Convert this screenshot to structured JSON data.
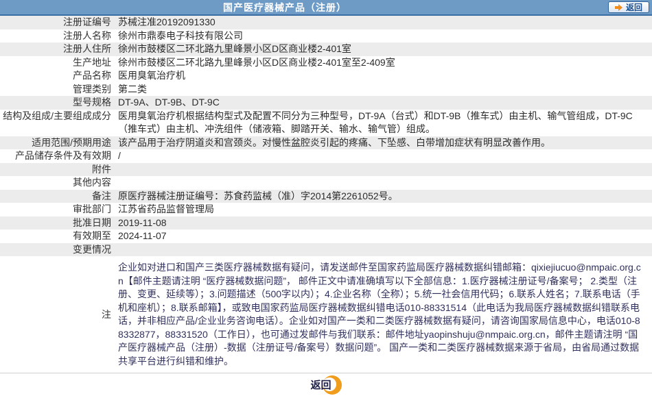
{
  "header": {
    "title": "国产医疗器械产品（注册）",
    "back_label": "返回"
  },
  "table": {
    "rows": [
      {
        "label": "注册证编号",
        "value": "苏械注准20192091330",
        "shaded": true
      },
      {
        "label": "注册人名称",
        "value": "徐州市鼎泰电子科技有限公司",
        "shaded": false
      },
      {
        "label": "注册人住所",
        "value": "徐州市鼓楼区二环北路九里峰景小区D区商业楼2-401室",
        "shaded": true
      },
      {
        "label": "生产地址",
        "value": "徐州市鼓楼区二环北路九里峰景小区D区商业楼2-401室至2-409室",
        "shaded": false
      },
      {
        "label": "产品名称",
        "value": "医用臭氧治疗机",
        "shaded": false
      },
      {
        "label": "管理类别",
        "value": "第二类",
        "shaded": false
      },
      {
        "label": "型号规格",
        "value": "DT-9A、DT-9B、DT-9C",
        "shaded": true
      },
      {
        "label": "结构及组成/主要组成成分",
        "value": "医用臭氧治疗机根据结构型式及配置不同分为三种型号，DT-9A（台式）和DT-9B（推车式）由主机、输气管组成，DT-9C（推车式）由主机、冲洗组件（储液箱、脚踏开关、输水、输气管）组成。",
        "shaded": false
      },
      {
        "label": "适用范围/预期用途",
        "value": "该产品用于治疗阴道炎和宫颈炎。对慢性盆腔炎引起的疼痛、下坠感、白带增加症状有明显改善作用。",
        "shaded": true
      },
      {
        "label": "产品储存条件及有效期",
        "value": "/",
        "shaded": false
      },
      {
        "label": "附件",
        "value": "",
        "shaded": true
      },
      {
        "label": "其他内容",
        "value": "",
        "shaded": false
      },
      {
        "label": "备注",
        "value": "原医疗器械注册证编号：苏食药监械（准）字2014第2261052号。",
        "shaded": true
      },
      {
        "label": "审批部门",
        "value": "江苏省药品监督管理局",
        "shaded": false
      },
      {
        "label": "批准日期",
        "value": "2019-11-08",
        "shaded": true
      },
      {
        "label": "有效期至",
        "value": "2024-11-07",
        "shaded": false
      },
      {
        "label": "变更情况",
        "value": "",
        "shaded": true
      }
    ]
  },
  "note": {
    "label": "注",
    "text": "企业如对进口和国产三类医疗器械数据有疑问，请发送邮件至国家药监局医疗器械数据纠错邮箱：qixiejiucuo@nmpaic.org.cn【邮件主题请注明 “医疗器械数据问题”， 邮件正文中请准确填写以下全部信息：1.医疗器械注册证号/备案号； 2.类型（注册、变更、延续等）；3.问题描述（500字以内）；4.企业名称（全称）；5.统一社会信用代码；6.联系人姓名；7.联系电话（手机和座机）；8.联系邮箱】，或致电国家药监局医疗器械数据纠错电话010-88331514（此电话为我局医疗器械数据纠错联系电话，并非相应产品/企业业务咨询电话）。企业如对国产一类和二类医疗器械数据有疑问，请咨询国家局信息中心，电话010-88332877，88331520（工作日），也可通过发邮件与我们联系：邮件地址yaopinshuju@nmpaic.org.cn，邮件主题请注明 “国产医疗器械产品（注册）-数据（注册证号/备案号）数据问题”。 国产一类和二类医疗器械数据来源于省局，由省局通过数据共享平台进行纠错和维护。"
  },
  "footer": {
    "back_label": "返回"
  },
  "colors": {
    "header_bg": "#6d9bc5",
    "header_border": "#3a6da3",
    "row_stripe": "#ececec",
    "note_text": "#30305e",
    "accent_orange": "#f09c1c",
    "button_border": "#2f6199",
    "button_text": "#1a4f8f"
  }
}
